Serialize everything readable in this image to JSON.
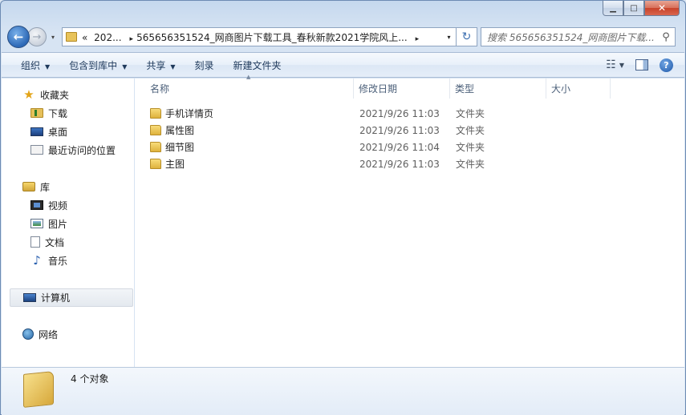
{
  "window": {
    "caption": {
      "minimize": "▁",
      "maximize": "□",
      "close": "✕"
    }
  },
  "navbar": {
    "back_icon": "←",
    "forward_icon": "→",
    "dropdown_icon": "▾",
    "address": {
      "overflow": "«",
      "crumbs": [
        "202...",
        "565656351524_网商图片下载工具_春秋新款2021学院风上..."
      ],
      "separator": "▸"
    },
    "refresh_icon": "↻",
    "search_placeholder": "搜索 565656351524_网商图片下载...",
    "search_icon": "⚲"
  },
  "toolbar": {
    "organize": "组织",
    "include_in_library": "包含到库中",
    "share": "共享",
    "burn": "刻录",
    "new_folder": "新建文件夹",
    "view_icon": "☷",
    "help": "?"
  },
  "sidebar": {
    "favorites": "收藏夹",
    "downloads": "下载",
    "desktop": "桌面",
    "recent": "最近访问的位置",
    "libraries": "库",
    "videos": "视频",
    "pictures": "图片",
    "documents": "文档",
    "music": "音乐",
    "computer": "计算机",
    "network": "网络"
  },
  "columns": {
    "name": "名称",
    "date": "修改日期",
    "type": "类型",
    "size": "大小"
  },
  "files": [
    {
      "name": "手机详情页",
      "date": "2021/9/26 11:03",
      "type": "文件夹"
    },
    {
      "name": "属性图",
      "date": "2021/9/26 11:03",
      "type": "文件夹"
    },
    {
      "name": "细节图",
      "date": "2021/9/26 11:04",
      "type": "文件夹"
    },
    {
      "name": "主图",
      "date": "2021/9/26 11:03",
      "type": "文件夹"
    }
  ],
  "details": {
    "status": "4 个对象"
  }
}
